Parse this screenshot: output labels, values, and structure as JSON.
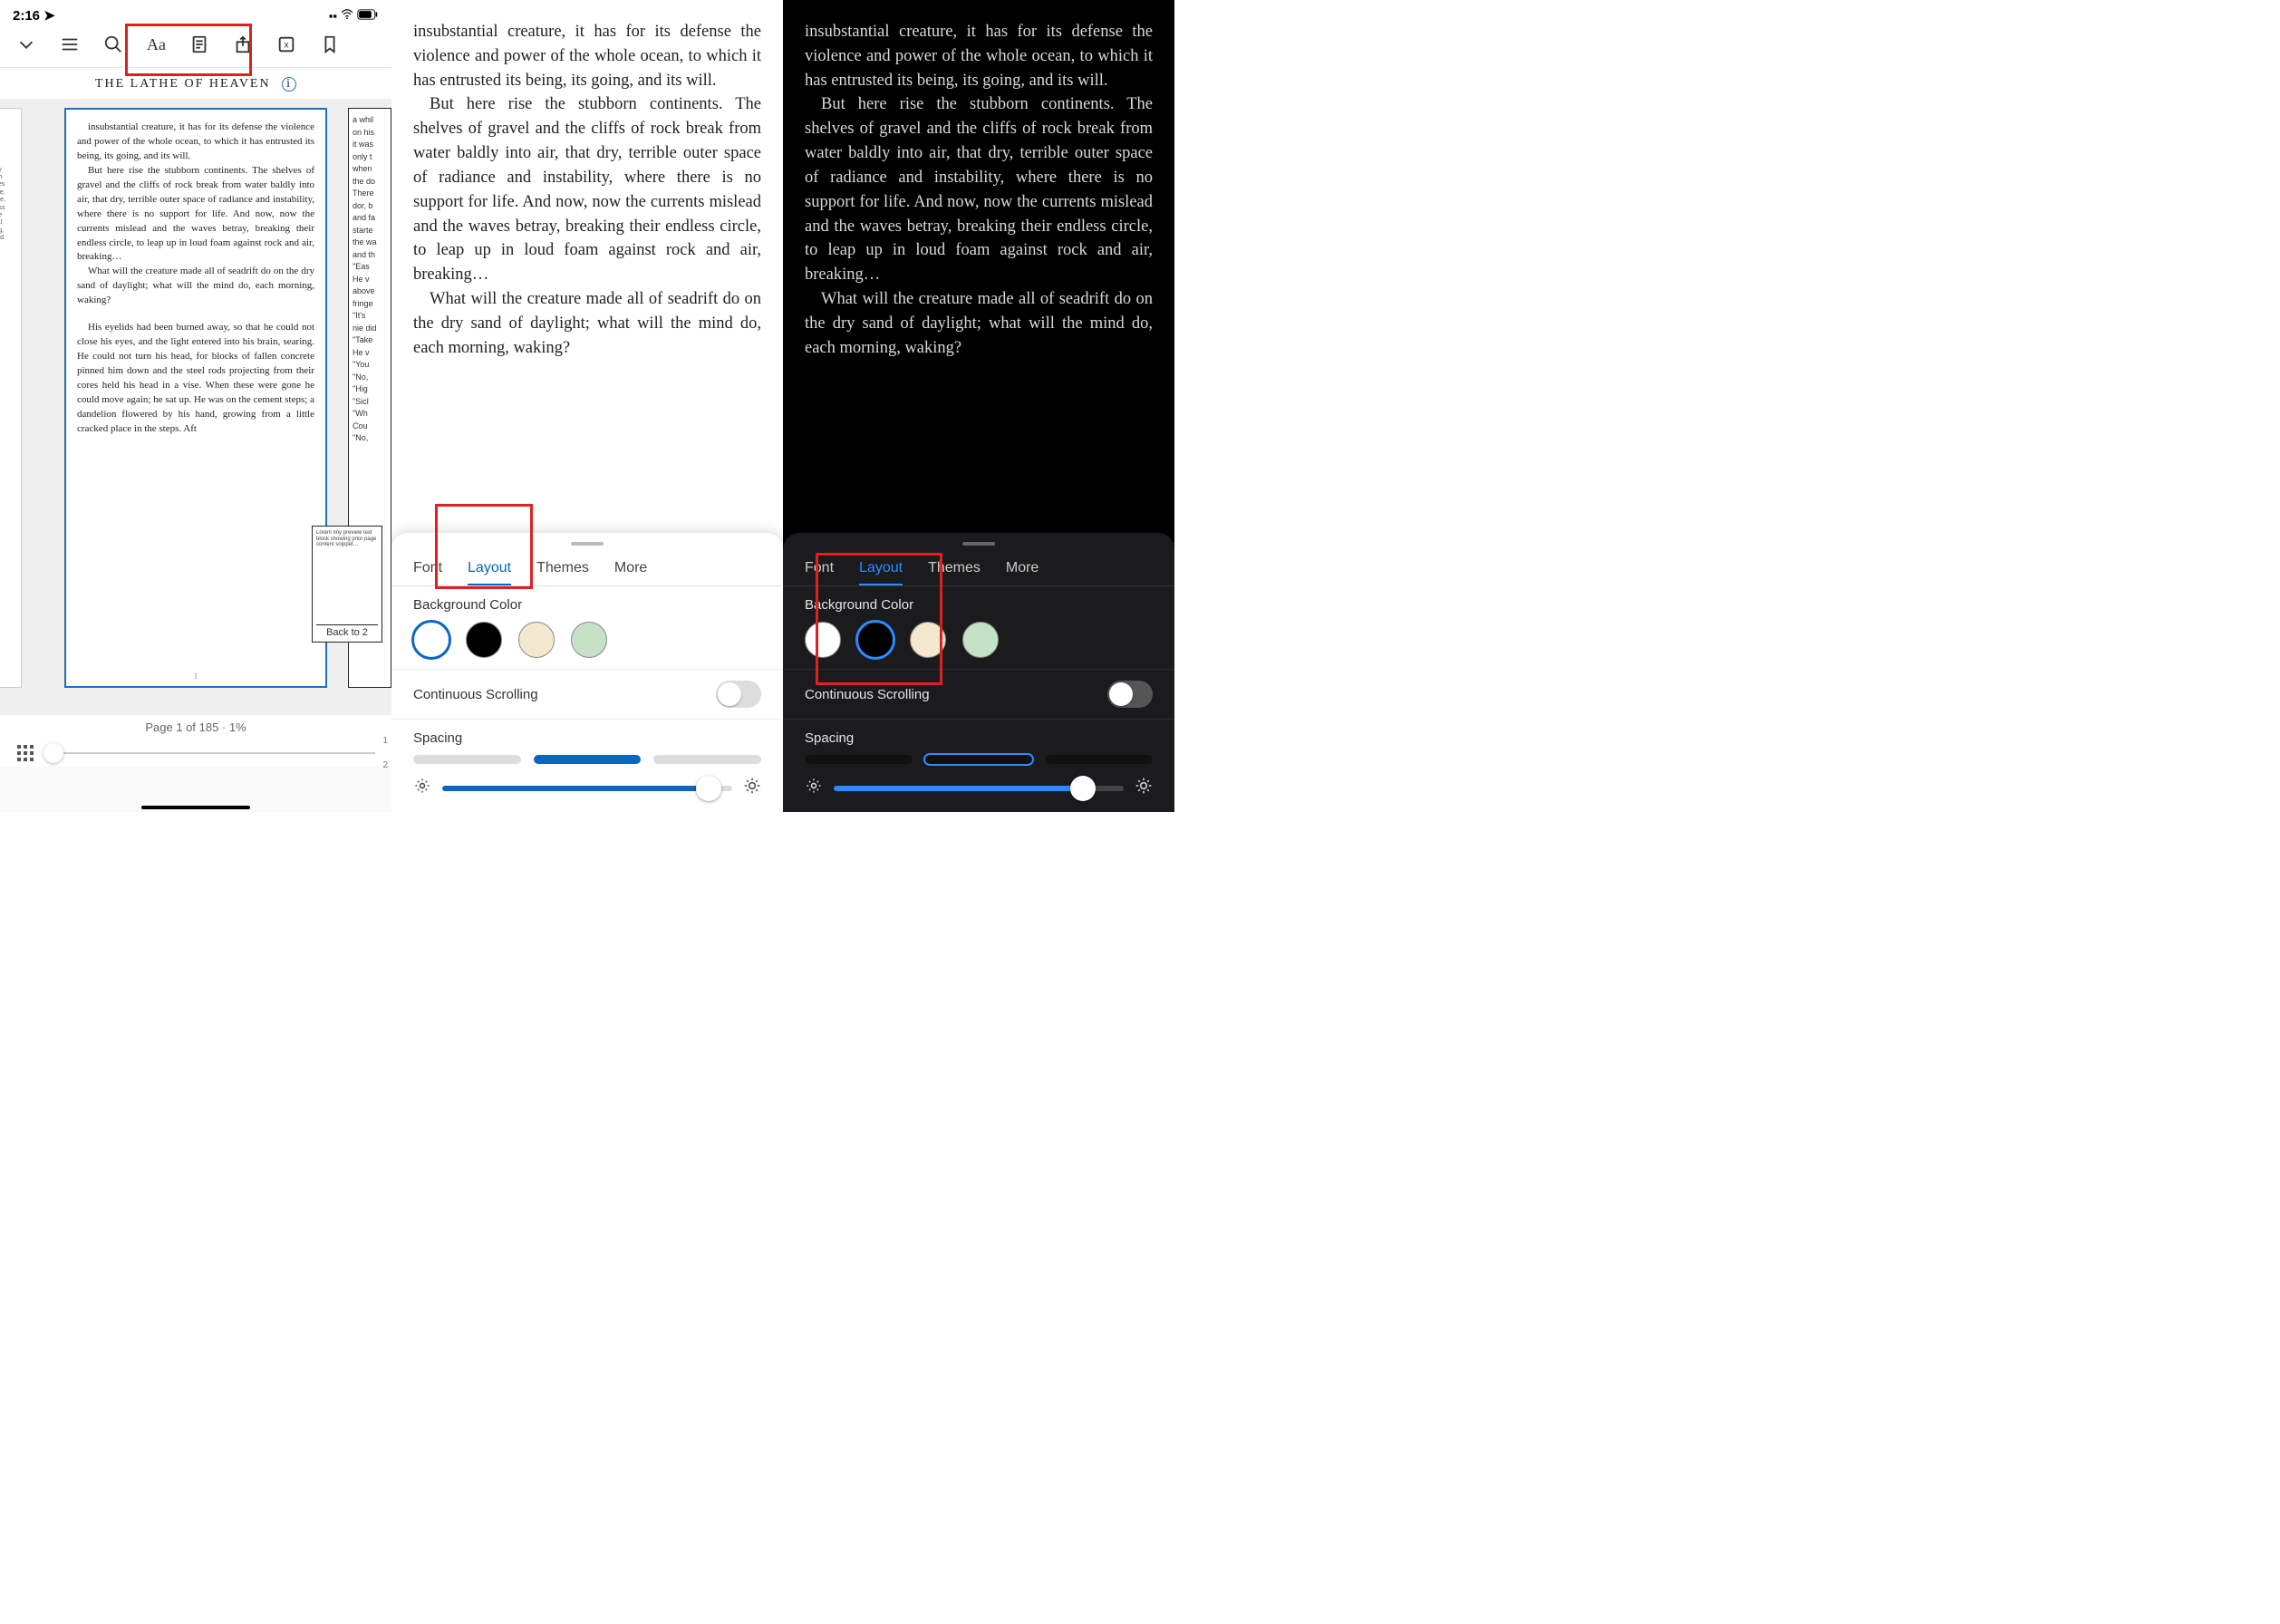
{
  "status": {
    "time": "2:16",
    "signal": "▪▫",
    "wifi": "􀙇",
    "battery": "80"
  },
  "book": {
    "title": "THE LATHE OF HEAVEN",
    "page_indicator": "Page 1 of 185 · 1%",
    "slider_labels": {
      "top": "1",
      "bottom": "2"
    },
    "back_to": "Back to 2",
    "thumb_page": "1",
    "para1": "insubstantial creature, it has for its defense the violence and power of the whole ocean, to which it has entrusted its being, its going, and its will.",
    "para2": "But here rise the stubborn continents. The shelves of gravel and the cliffs of rock break from water baldly into air, that dry, ter­rible outer space of radiance and instability, where there is no support for life. And now, now the currents mislead and the waves be­tray, breaking their endless circle, to leap up in loud foam against rock and air, breaking…",
    "para3": "What will the creature made all of sea­drift do on the dry sand of daylight; what will the mind do, each morning, waking?",
    "para4": "His eyelids had been burned away, so that he could not close his eyes, and the light en­tered into his brain, searing. He could not turn his head, for blocks of fallen concrete pinned him down and the steel rods pro­jecting from their cores held his head in a vise. When these were gone he could move again; he sat up. He was on the cement steps; a dandelion flowered by his hand, growing from a little cracked place in the steps. Aft"
  },
  "left_peek": {
    "lines": [
      "ns,",
      "n a",
      "To-",
      "it;",
      "en",
      "",
      ": II",
      "",
      "ugely",
      "llyfish",
      "shines",
      "Borne,",
      "where,",
      "mpass",
      "move",
      "iurnal",
      "nging,",
      "le and"
    ]
  },
  "right_peek": {
    "lines": [
      "a whil",
      "on his",
      "it was",
      "only t",
      "when",
      "the do",
      "There",
      "dor, b",
      "and fa",
      "starte",
      "the wa",
      "and th",
      "\"Eas",
      "He v",
      "above",
      "fringe",
      "\"It's",
      "nie did",
      "\"Take",
      "He v",
      "\"You",
      "\"No,",
      "\"Hig",
      "\"Sicl",
      "\"Wh",
      "Cou",
      "\"No,"
    ]
  },
  "sheet": {
    "tabs": {
      "font": "Font",
      "layout": "Layout",
      "themes": "Themes",
      "more": "More"
    },
    "bg_label": "Background Color",
    "scroll_label": "Continuous Scrolling",
    "spacing_label": "Spacing"
  }
}
